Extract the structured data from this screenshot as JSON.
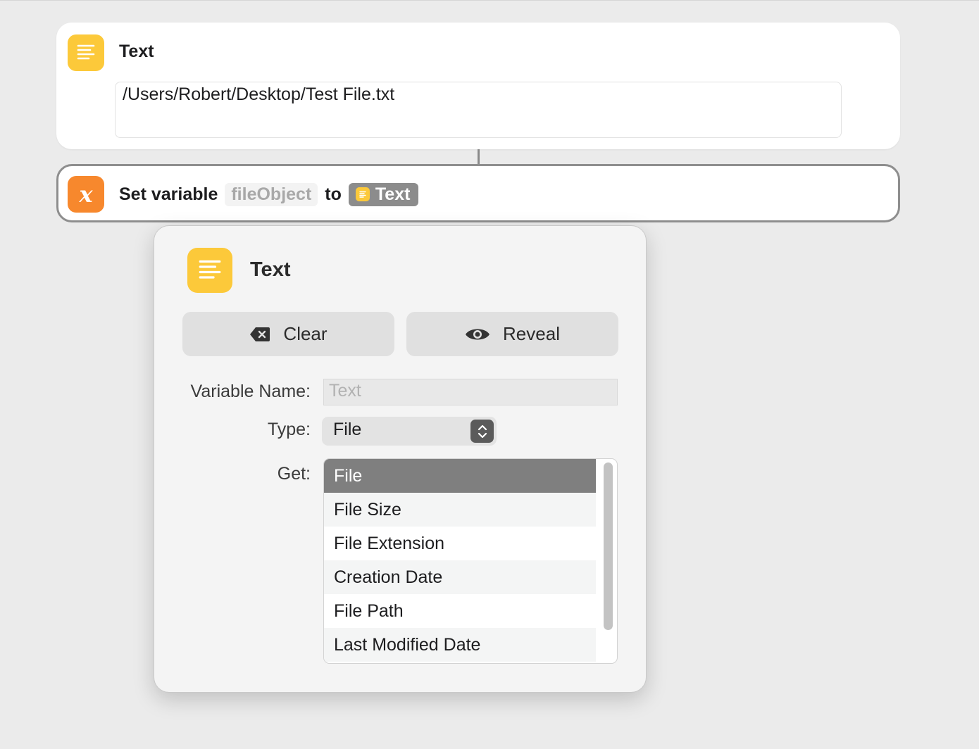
{
  "text_action": {
    "title": "Text",
    "value": "/Users/Robert/Desktop/Test File.txt",
    "icon": "text-lines-icon"
  },
  "setvar_action": {
    "label": "Set variable",
    "variable": "fileObject",
    "to": "to",
    "token_label": "Text",
    "icon": "variable-x-icon"
  },
  "popover": {
    "title": "Text",
    "clear_label": "Clear",
    "reveal_label": "Reveal",
    "variable_name_label": "Variable Name:",
    "variable_name_placeholder": "Text",
    "type_label": "Type:",
    "type_value": "File",
    "get_label": "Get:",
    "get_items": [
      "File",
      "File Size",
      "File Extension",
      "Creation Date",
      "File Path",
      "Last Modified Date"
    ],
    "get_selected": "File"
  },
  "colors": {
    "text_icon": "#fcc93a",
    "variable_icon": "#f7882d",
    "selected_row": "#7f7f7f"
  }
}
